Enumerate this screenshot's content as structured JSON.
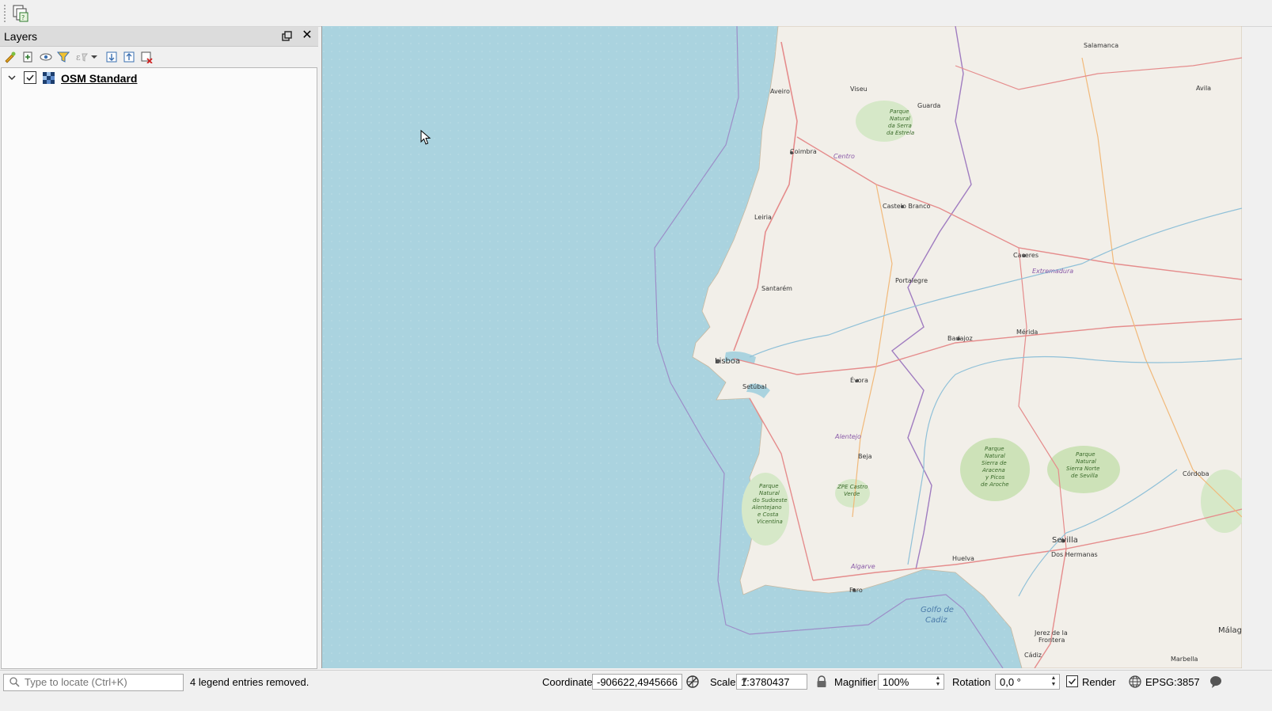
{
  "toolbar": {
    "tool_icon": "multi-window-icon"
  },
  "layers_panel": {
    "title": "Layers",
    "tools": [
      "open-layer-styling-icon",
      "add-group-icon",
      "manage-visibility-icon",
      "filter-legend-icon",
      "filter-expression-icon",
      "expand-all-icon",
      "collapse-all-icon",
      "remove-layer-icon"
    ],
    "layers": [
      {
        "name": "OSM Standard",
        "checked": true,
        "expanded": true
      }
    ]
  },
  "map": {
    "labels": [
      "Aveiro",
      "Viseu",
      "Guarda",
      "Parque",
      "Natural",
      "da Serra",
      "da Estrela",
      "Coimbra",
      "Centro",
      "Castelo Branco",
      "Leiria",
      "Caceres",
      "Extremadura",
      "Santarém",
      "Portalegre",
      "Lisboa",
      "Setúbal",
      "Badajoz",
      "Mérida",
      "Évora",
      "Alentejo",
      "Beja",
      "ZPE Castro",
      "Verde",
      "Parque",
      "Natural",
      "Sierra de",
      "Aracena",
      "y Picos",
      "de Aroche",
      "Parque",
      "Natural",
      "Sierra Norte",
      "de Sevilla",
      "Córdoba",
      "Parque",
      "Natural",
      "do Sudoeste",
      "Alentejano",
      "e Costa",
      "Vicentina",
      "Sevilla",
      "Dos Hermanas",
      "Huelva",
      "Algarve",
      "Faro",
      "Golfo de",
      "Cadiz",
      "Jerez de la",
      "Frontera",
      "Málaga",
      "Cádiz",
      "Marbella",
      "Salamanca",
      "Avila"
    ]
  },
  "statusbar": {
    "locator_placeholder": "Type to locate (Ctrl+K)",
    "message": "4 legend entries removed.",
    "coordinate_label": "Coordinate",
    "coordinate_value": "-906622,4945666",
    "scale_label": "Scale",
    "scale_value": "1:3780437",
    "magnifier_label": "Magnifier",
    "magnifier_value": "100%",
    "rotation_label": "Rotation",
    "rotation_value": "0,0 °",
    "render_label": "Render",
    "render_checked": true,
    "crs": "EPSG:3857"
  }
}
